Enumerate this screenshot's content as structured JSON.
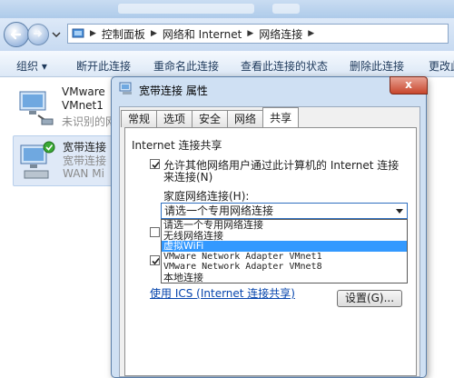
{
  "breadcrumb": [
    "控制面板",
    "网络和 Internet",
    "网络连接"
  ],
  "toolbar": {
    "organize": "组织 ▾",
    "disable": "断开此连接",
    "rename": "重命名此连接",
    "status": "查看此连接的状态",
    "delete": "删除此连接",
    "more": "更改此"
  },
  "connections": [
    {
      "name": "VMware",
      "sub": "VMnet1",
      "status": "未识别的网络"
    },
    {
      "name": "宽带连接",
      "sub": "宽带连接",
      "status": "WAN Mi"
    }
  ],
  "dialog": {
    "title": "宽带连接 属性",
    "close": "x",
    "tabs": [
      "常规",
      "选项",
      "安全",
      "网络",
      "共享"
    ],
    "group": "Internet 连接共享",
    "allow_line1": "允许其他网络用户通过此计算机的 Internet 连接",
    "allow_line2": "来连接(N)",
    "home_label": "家庭网络连接(H):",
    "combo_value": "请选一个专用网络连接",
    "options": [
      "请选一个专用网络连接",
      "无线网络连接",
      "虚拟WiFi",
      "VMware Network Adapter VMnet1",
      "VMware Network Adapter VMnet8",
      "本地连接"
    ],
    "highlighted_index": 2,
    "link": "使用 ICS (Internet 连接共享)",
    "settings_button": "设置(G)..."
  },
  "colors": {
    "highlight": "#3399ff",
    "link": "#0645ad"
  }
}
